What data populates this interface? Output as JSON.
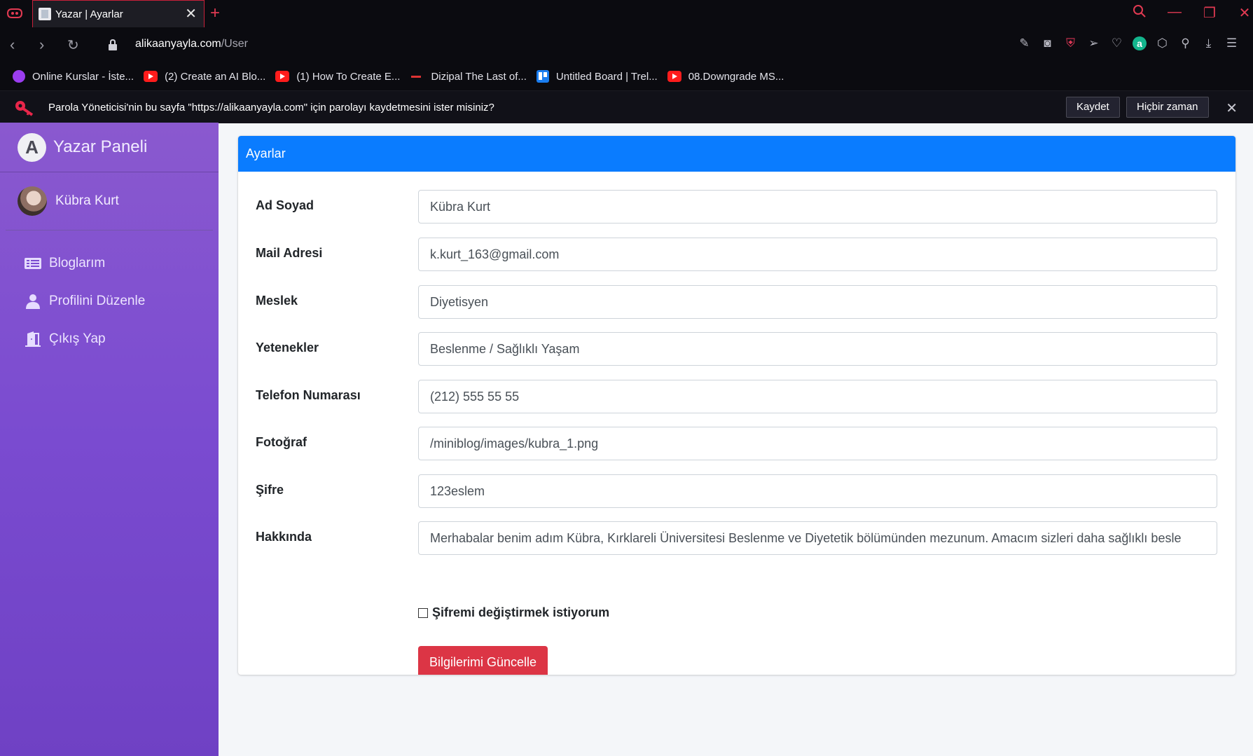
{
  "browser": {
    "tab_title": "Yazar | Ayarlar",
    "url_host": "alikaanyayla.com",
    "url_path": "/User",
    "bookmarks": [
      {
        "label": "Online Kurslar - İste...",
        "icon": "udemy-icon"
      },
      {
        "label": "(2) Create an AI Blo...",
        "icon": "youtube-icon"
      },
      {
        "label": "(1) How To Create E...",
        "icon": "youtube-icon"
      },
      {
        "label": "Dizipal The Last of...",
        "icon": "dizipal-icon"
      },
      {
        "label": "Untitled Board | Trel...",
        "icon": "trello-icon"
      },
      {
        "label": "08.Downgrade MS...",
        "icon": "youtube-icon"
      }
    ]
  },
  "password_bar": {
    "message": "Parola Yöneticisi'nin bu sayfa \"https://alikaanyayla.com\" için parolayı kaydetmesini ister misiniz?",
    "save_label": "Kaydet",
    "never_label": "Hiçbir zaman"
  },
  "sidebar": {
    "brand": "Yazar Paneli",
    "brand_logo_letter": "A",
    "user_name": "Kübra Kurt",
    "items": [
      {
        "label": "Bloglarım",
        "icon": "list-icon"
      },
      {
        "label": "Profilini Düzenle",
        "icon": "user-icon"
      },
      {
        "label": "Çıkış Yap",
        "icon": "door-exit-icon"
      }
    ]
  },
  "card": {
    "title": "Ayarlar",
    "fields": [
      {
        "label": "Ad Soyad",
        "value": "Kübra Kurt"
      },
      {
        "label": "Mail Adresi",
        "value": "k.kurt_163@gmail.com"
      },
      {
        "label": "Meslek",
        "value": "Diyetisyen"
      },
      {
        "label": "Yetenekler",
        "value": "Beslenme / Sağlıklı Yaşam"
      },
      {
        "label": "Telefon Numarası",
        "value": "(212) 555 55 55"
      },
      {
        "label": "Fotoğraf",
        "value": "/miniblog/images/kubra_1.png"
      },
      {
        "label": "Şifre",
        "value": "123eslem"
      },
      {
        "label": "Hakkında",
        "value": "Merhabalar benim adım Kübra, Kırklareli Üniversitesi Beslenme ve Diyetetik bölümünden mezunum. Amacım sizleri daha sağlıklı besle"
      }
    ],
    "checkbox_label": "Şifremi değiştirmek istiyorum",
    "submit_label": "Bilgilerimi Güncelle"
  },
  "colors": {
    "accent_blue": "#0a7cff",
    "danger_red": "#dc3545",
    "sidebar_purple": "#7a4bd0"
  }
}
